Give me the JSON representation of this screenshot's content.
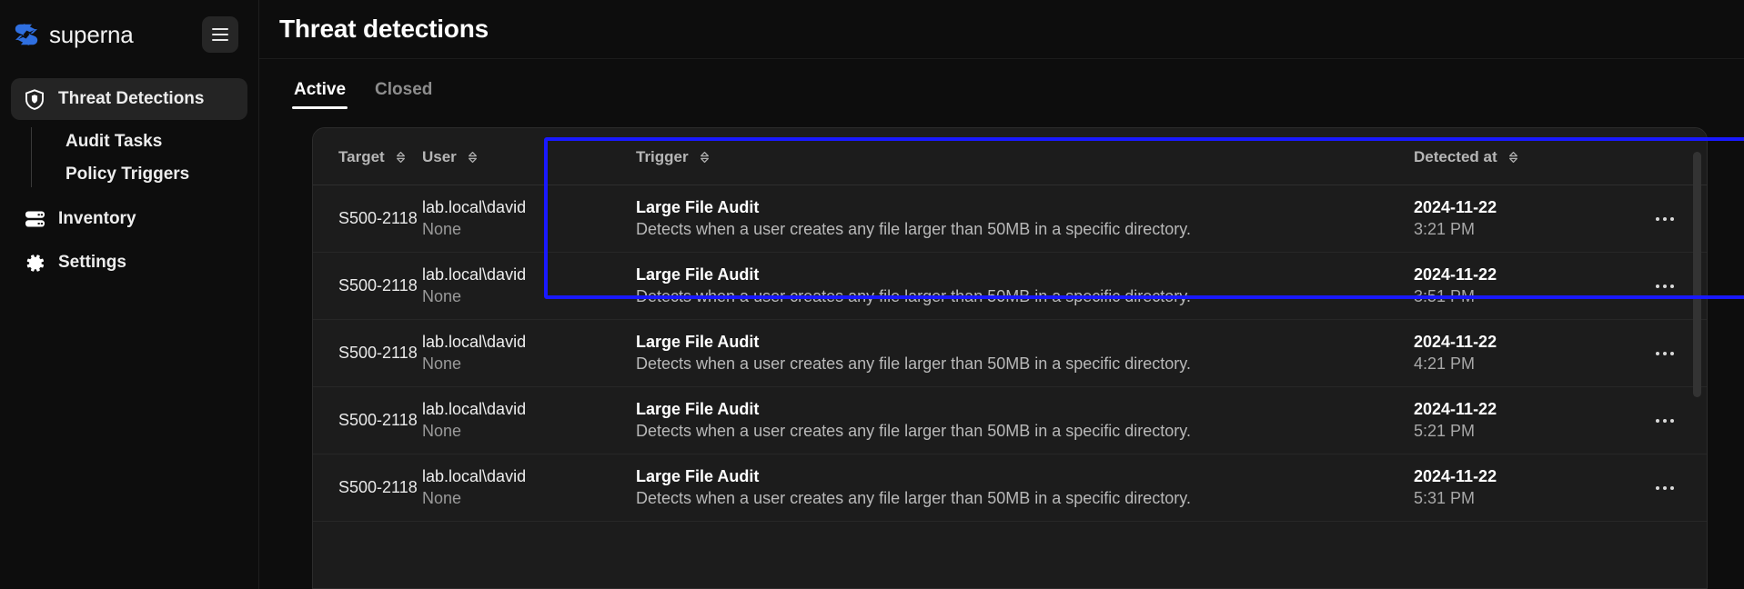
{
  "brand": {
    "name": "superna",
    "logo_color": "#2f6fe0"
  },
  "sidebar": {
    "menu_icon": "hamburger-icon",
    "items": [
      {
        "label": "Threat Detections",
        "icon": "shield-icon",
        "active": true
      },
      {
        "label": "Audit Tasks",
        "icon": "none",
        "sub": true
      },
      {
        "label": "Policy Triggers",
        "icon": "none",
        "sub": true
      },
      {
        "label": "Inventory",
        "icon": "server-stack-icon",
        "active": false
      },
      {
        "label": "Settings",
        "icon": "gear-icon",
        "active": false
      }
    ]
  },
  "header": {
    "title": "Threat detections"
  },
  "tabs": [
    {
      "label": "Active",
      "active": true
    },
    {
      "label": "Closed",
      "active": false
    }
  ],
  "table": {
    "columns": [
      {
        "label": "Target",
        "sortable": true
      },
      {
        "label": "User",
        "sortable": true
      },
      {
        "label": "Trigger",
        "sortable": true
      },
      {
        "label": "Detected at",
        "sortable": true
      }
    ],
    "row_menu_icon": "kebab-menu-icon",
    "rows": [
      {
        "target": "S500-2118",
        "user": "lab.local\\david",
        "user_secondary": "None",
        "trigger_title": "Large File Audit",
        "trigger_desc": "Detects when a user creates any file larger than 50MB in a specific directory.",
        "date": "2024-11-22",
        "time": "3:21 PM",
        "highlighted": true
      },
      {
        "target": "S500-2118",
        "user": "lab.local\\david",
        "user_secondary": "None",
        "trigger_title": "Large File Audit",
        "trigger_desc": "Detects when a user creates any file larger than 50MB in a specific directory.",
        "date": "2024-11-22",
        "time": "3:51 PM",
        "highlighted": false
      },
      {
        "target": "S500-2118",
        "user": "lab.local\\david",
        "user_secondary": "None",
        "trigger_title": "Large File Audit",
        "trigger_desc": "Detects when a user creates any file larger than 50MB in a specific directory.",
        "date": "2024-11-22",
        "time": "4:21 PM",
        "highlighted": false
      },
      {
        "target": "S500-2118",
        "user": "lab.local\\david",
        "user_secondary": "None",
        "trigger_title": "Large File Audit",
        "trigger_desc": "Detects when a user creates any file larger than 50MB in a specific directory.",
        "date": "2024-11-22",
        "time": "5:21 PM",
        "highlighted": false
      },
      {
        "target": "S500-2118",
        "user": "lab.local\\david",
        "user_secondary": "None",
        "trigger_title": "Large File Audit",
        "trigger_desc": "Detects when a user creates any file larger than 50MB in a specific directory.",
        "date": "2024-11-22",
        "time": "5:31 PM",
        "highlighted": false
      }
    ]
  },
  "highlight": {
    "color": "#1919ff"
  }
}
